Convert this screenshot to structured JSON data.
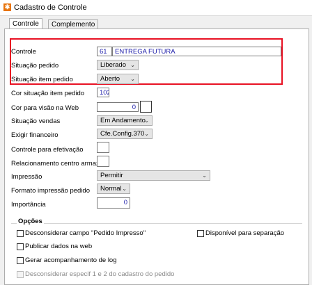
{
  "window": {
    "title": "Cadastro de Controle",
    "icon": "app-logo-icon"
  },
  "tabs": [
    {
      "label": "Controle"
    },
    {
      "label": "Complemento"
    }
  ],
  "form": {
    "controle": {
      "label": "Controle",
      "code": "61",
      "name": "ENTREGA FUTURA"
    },
    "situacao_pedido": {
      "label": "Situação pedido",
      "value": "Liberado"
    },
    "situacao_item_pedido": {
      "label": "Situação item pedido",
      "value": "Aberto"
    },
    "cor_situacao_item_pedido": {
      "label": "Cor situação item pedido",
      "value": "102"
    },
    "cor_visao_web": {
      "label": "Cor para visão na Web",
      "value": "0"
    },
    "situacao_vendas": {
      "label": "Situação vendas",
      "value": "Em Andamento"
    },
    "exigir_financeiro": {
      "label": "Exigir financeiro",
      "value": "Cfe.Config.370"
    },
    "controle_efetivacao": {
      "label": "Controle para efetivação",
      "value": ""
    },
    "relacionamento_centro": {
      "label": "Relacionamento centro armaz.",
      "value": ""
    },
    "impressao": {
      "label": "Impressão",
      "value": "Permitir"
    },
    "formato_impressao": {
      "label": "Formato impressão pedido",
      "value": "Normal"
    },
    "importancia": {
      "label": "Importância",
      "value": "0"
    }
  },
  "options": {
    "title": "Opções",
    "items": [
      {
        "label": "Desconsiderar campo \"Pedido Impresso\"",
        "checked": false,
        "enabled": true
      },
      {
        "label": "Disponível para separação",
        "checked": false,
        "enabled": true
      },
      {
        "label": "Publicar dados na web",
        "checked": false,
        "enabled": true
      },
      {
        "label": "Gerar acompanhamento de log",
        "checked": false,
        "enabled": true
      },
      {
        "label": "Desconsiderar especif 1 e 2 do cadastro do pedido",
        "checked": false,
        "enabled": false
      }
    ]
  },
  "highlight_color": "#e81123"
}
